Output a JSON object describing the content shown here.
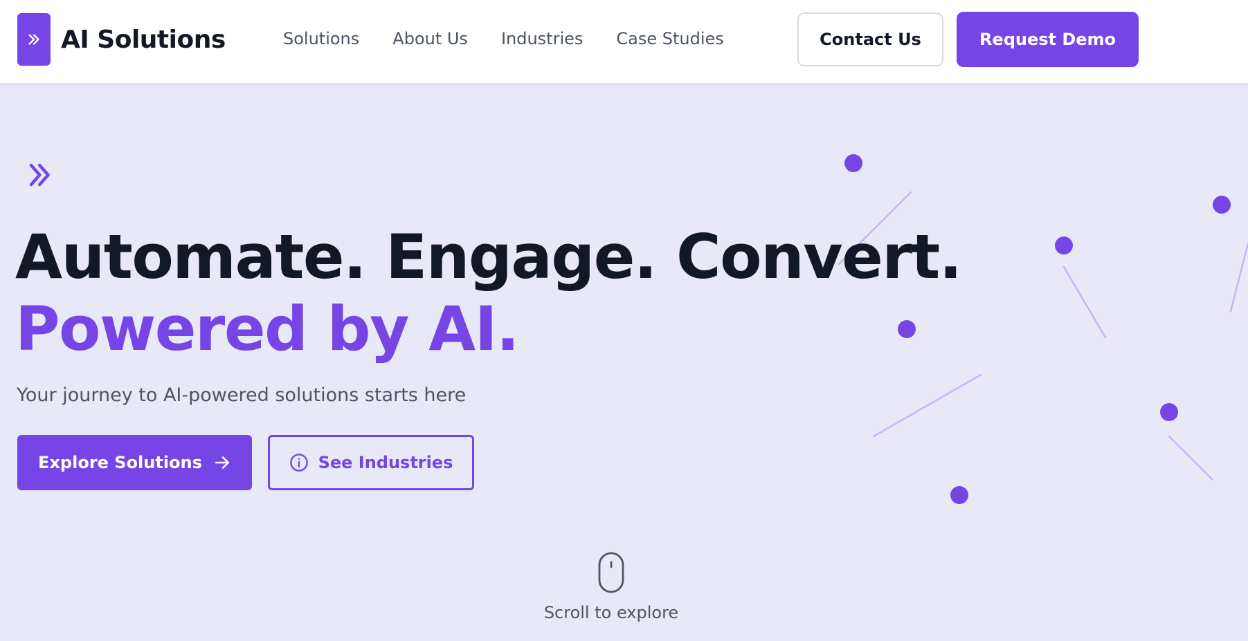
{
  "header": {
    "brand_title": "AI Solutions",
    "brand_icon": "double-chevron-right-icon",
    "nav": [
      {
        "label": "Solutions"
      },
      {
        "label": "About Us"
      },
      {
        "label": "Industries"
      },
      {
        "label": "Case Studies"
      }
    ],
    "contact_label": "Contact Us",
    "demo_label": "Request Demo"
  },
  "hero": {
    "chevron_icon": "double-chevron-right-icon",
    "headline_line1": "Automate. Engage. Convert.",
    "headline_line2": "Powered by AI.",
    "subtitle": "Your journey to AI-powered solutions starts here",
    "primary_cta": "Explore Solutions",
    "primary_cta_icon": "arrow-right-icon",
    "secondary_cta": "See Industries",
    "secondary_cta_icon": "info-icon",
    "scroll_text": "Scroll to explore",
    "scroll_icon": "mouse-icon"
  },
  "colors": {
    "accent": "#7645e6",
    "heading": "#121826",
    "body_text": "#4b5563",
    "hero_background": "#e8e8f7",
    "header_background": "#ffffff",
    "network_line": "#c3b6f4"
  }
}
